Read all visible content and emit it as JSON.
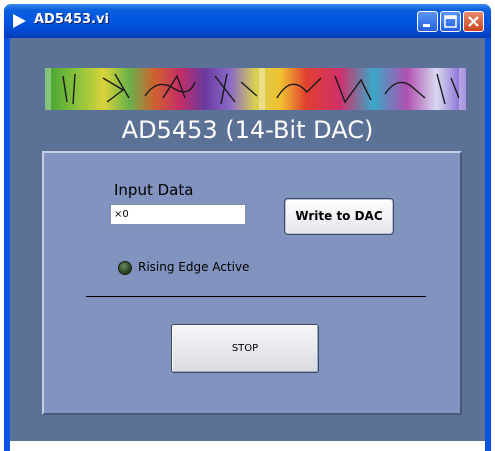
{
  "window": {
    "title": "AD5453.vi",
    "titlebar_color": "#0055e3",
    "panel_color": "#5c7196"
  },
  "titlebar_icons": [
    "play-icon",
    "minimize-icon",
    "maximize-icon",
    "close-icon"
  ],
  "banner": {
    "icon": "analog-devices-artwork-banner"
  },
  "main": {
    "heading": "AD5453 (14-Bit DAC)",
    "input": {
      "label": "Input Data",
      "value": "0",
      "radix_prefix": "×"
    },
    "write_button": "Write to DAC",
    "indicator": {
      "label": "Rising Edge Active",
      "state": "off",
      "color": "#2f4a27"
    },
    "stop_button": "STOP"
  }
}
